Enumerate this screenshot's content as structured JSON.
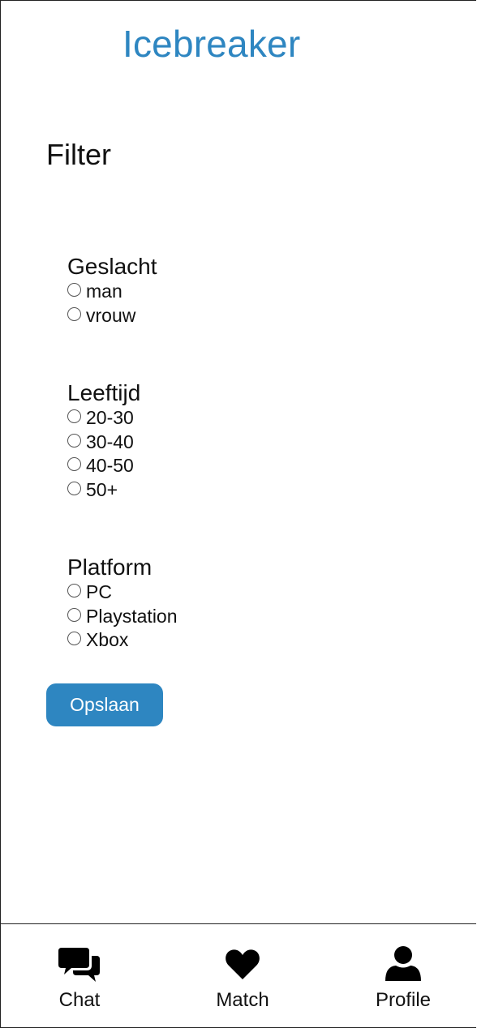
{
  "app": {
    "title": "Icebreaker",
    "accent_color": "#2e86c1"
  },
  "page": {
    "title": "Filter"
  },
  "filters": {
    "gender": {
      "title": "Geslacht",
      "options": [
        "man",
        "vrouw"
      ]
    },
    "age": {
      "title": "Leeftijd",
      "options": [
        "20-30",
        "30-40",
        "40-50",
        "50+"
      ]
    },
    "platform": {
      "title": "Platform",
      "options": [
        "PC",
        "Playstation",
        "Xbox"
      ]
    }
  },
  "actions": {
    "save_label": "Opslaan"
  },
  "bottom_nav": {
    "items": [
      {
        "label": "Chat",
        "icon": "chat-icon"
      },
      {
        "label": "Match",
        "icon": "heart-icon"
      },
      {
        "label": "Profile",
        "icon": "user-icon"
      }
    ]
  }
}
